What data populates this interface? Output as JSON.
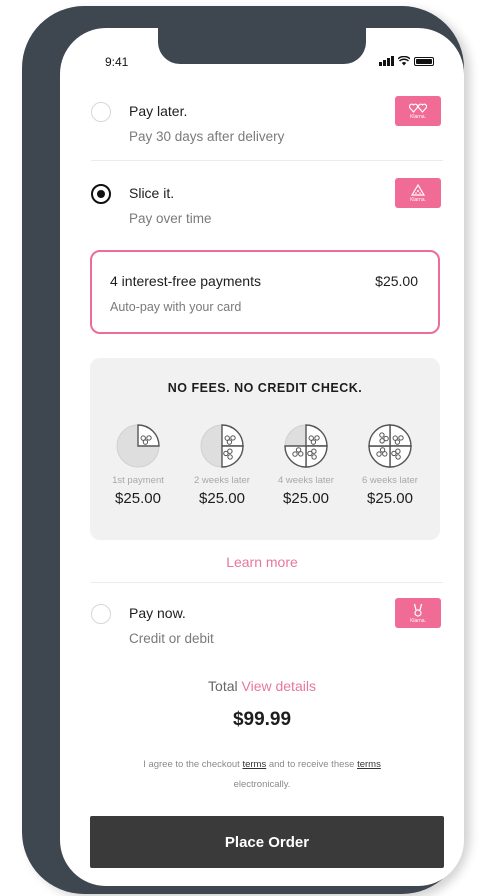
{
  "status": {
    "time": "9:41"
  },
  "options": [
    {
      "title": "Pay later.",
      "subtitle": "Pay 30 days after delivery",
      "selected": false,
      "icon": "hearts-icon"
    },
    {
      "title": "Slice it.",
      "subtitle": "Pay over time",
      "selected": true,
      "icon": "pizza-slice-icon"
    },
    {
      "title": "Pay now.",
      "subtitle": "Credit or debit",
      "selected": false,
      "icon": "bunny-icon"
    }
  ],
  "plan": {
    "title": "4 interest-free payments",
    "amount": "$25.00",
    "subtitle": "Auto-pay with your card"
  },
  "schedule": {
    "heading": "NO FEES. NO CREDIT CHECK.",
    "steps": [
      {
        "label": "1st payment",
        "amount": "$25.00",
        "slices_filled": 1
      },
      {
        "label": "2 weeks later",
        "amount": "$25.00",
        "slices_filled": 2
      },
      {
        "label": "4 weeks later",
        "amount": "$25.00",
        "slices_filled": 3
      },
      {
        "label": "6 weeks later",
        "amount": "$25.00",
        "slices_filled": 4
      }
    ]
  },
  "learn_more": "Learn more",
  "total": {
    "label": "Total",
    "link": "View details",
    "amount": "$99.99"
  },
  "agreement": {
    "p1": "I agree to the checkout",
    "terms1": "terms",
    "p2": "and to receive these",
    "terms2": "terms",
    "p3": "electronically."
  },
  "place_order": "Place Order",
  "colors": {
    "accent": "#ec6d98",
    "badge": "#f06b96",
    "frame": "#3e4650",
    "button": "#3a3a3a"
  }
}
